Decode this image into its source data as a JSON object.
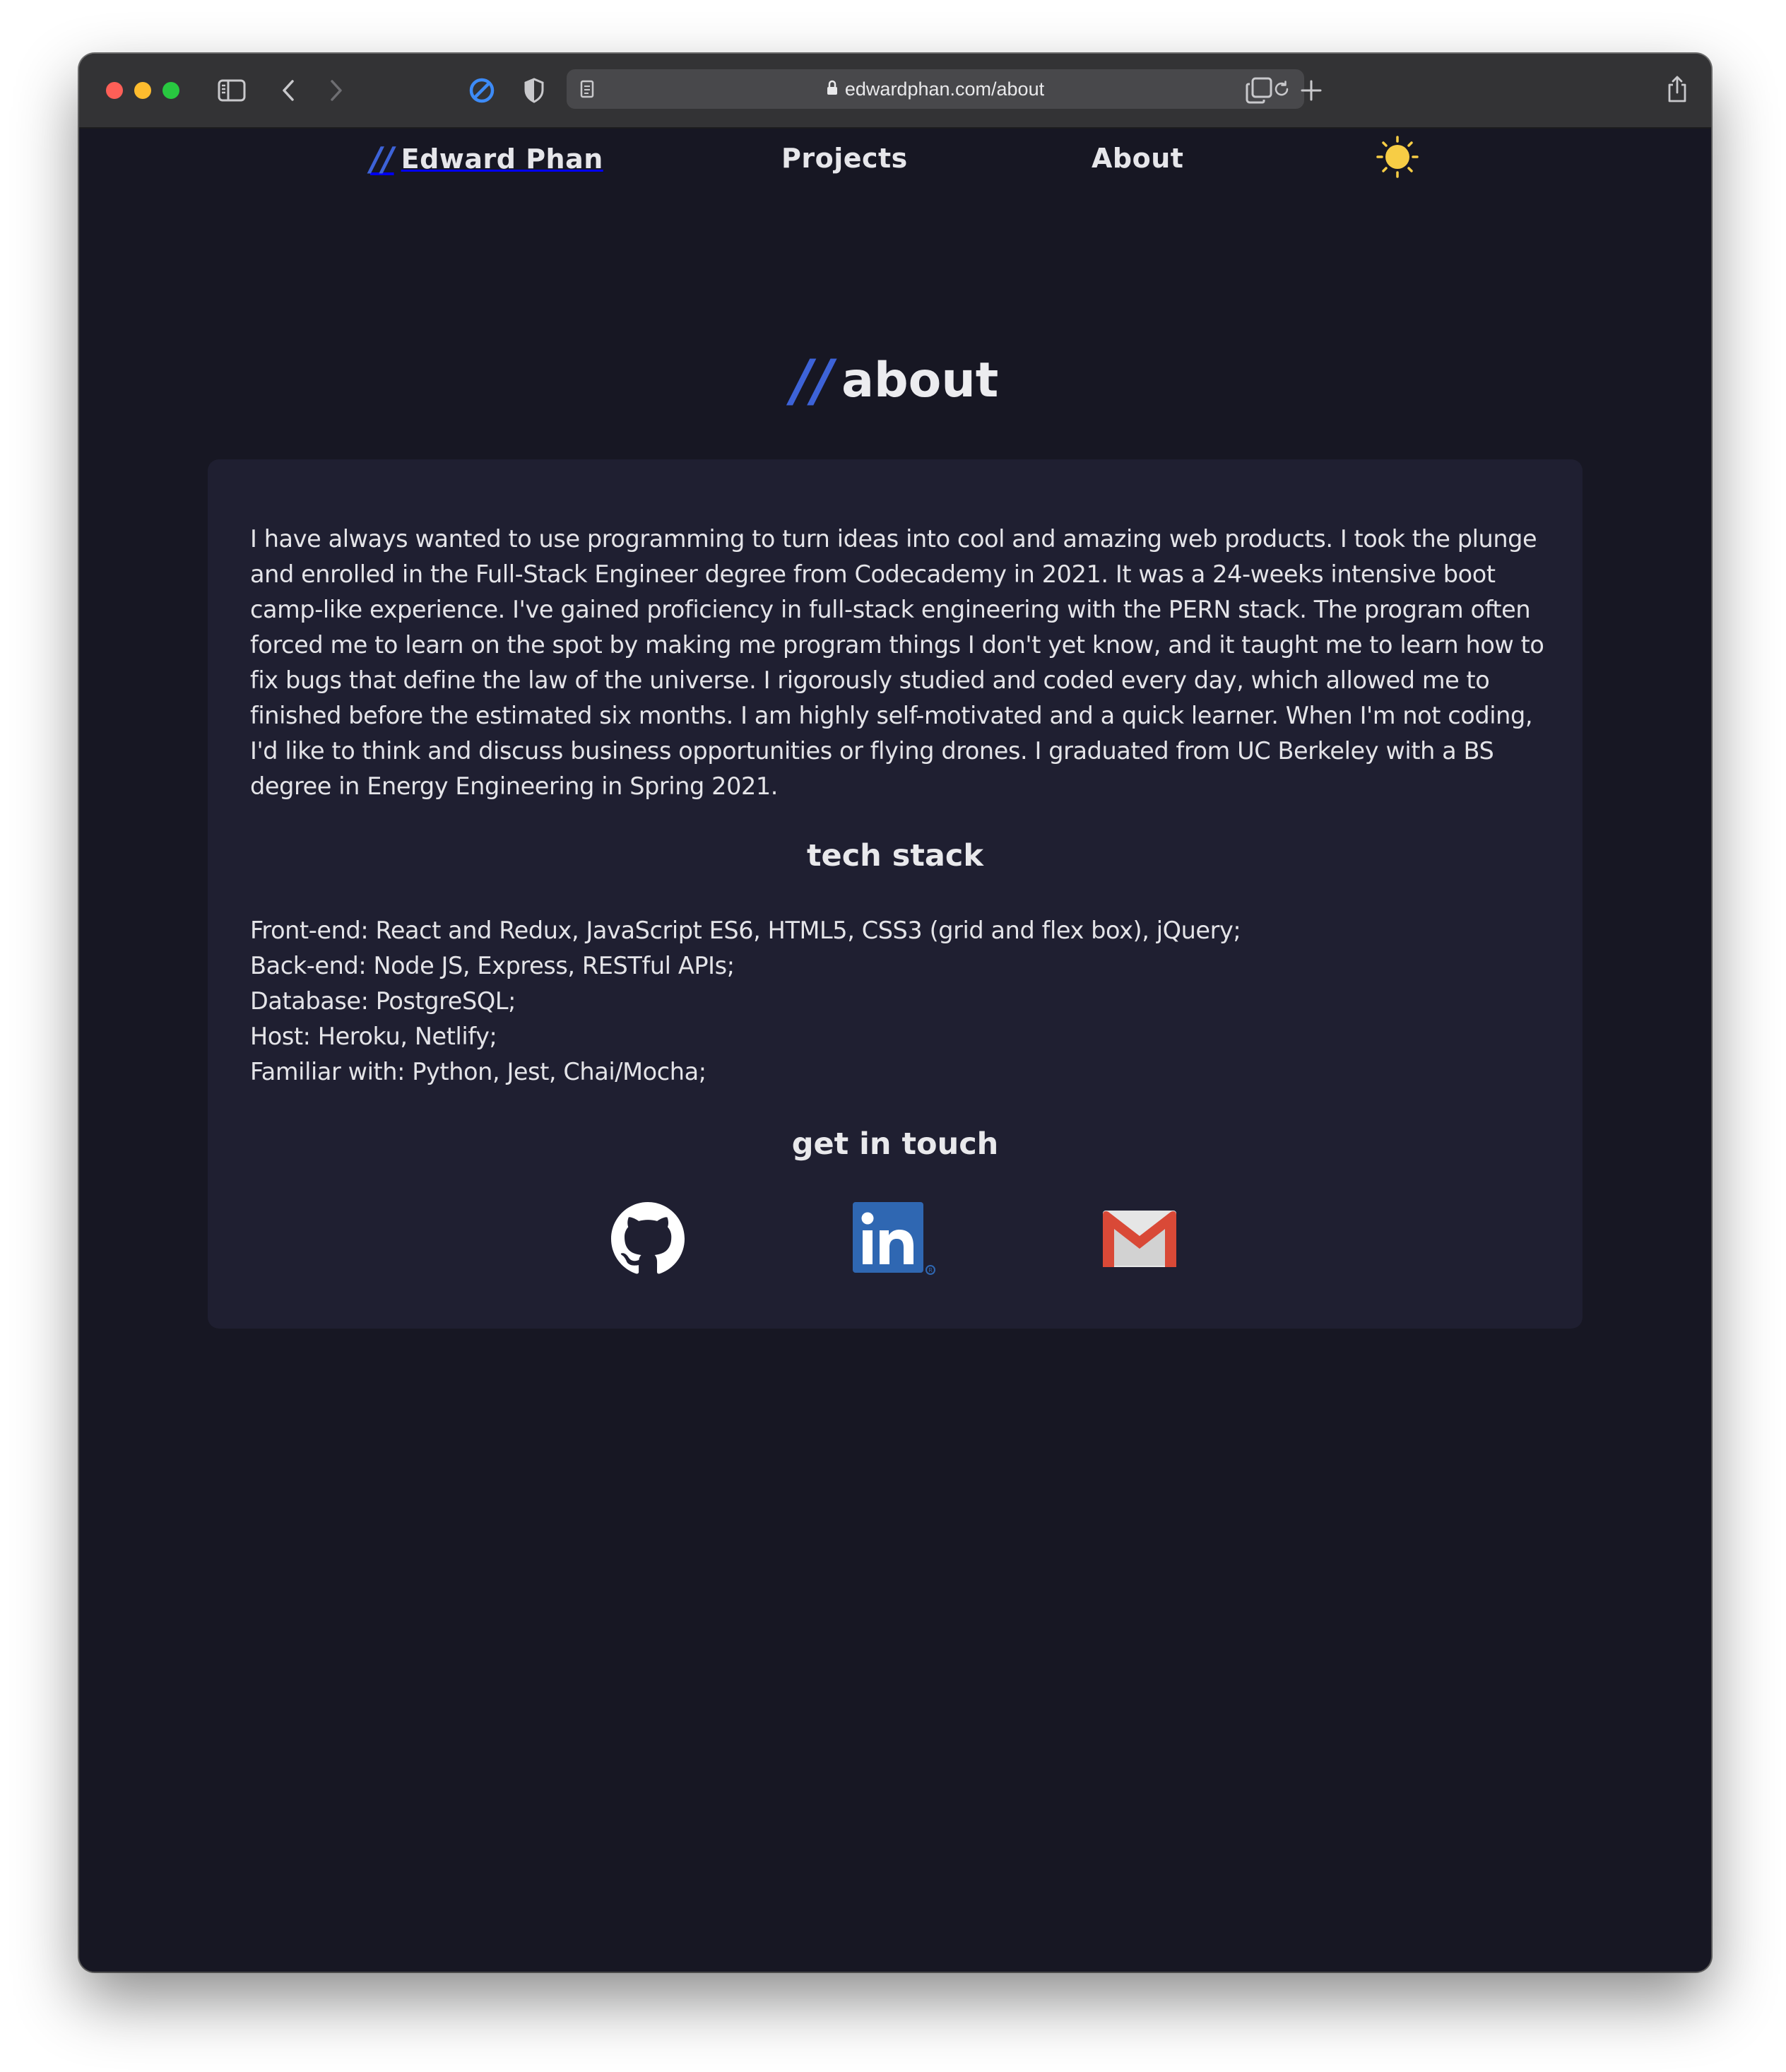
{
  "browser": {
    "url": "edwardphan.com/about"
  },
  "nav": {
    "brand_slashes": "//",
    "brand_name": "Edward Phan",
    "links": [
      {
        "label": "Projects"
      },
      {
        "label": "About"
      }
    ],
    "theme_icon": "sun-icon"
  },
  "about": {
    "heading_slashes": "//",
    "heading": "about",
    "bio": "I have always wanted to use programming to turn ideas into cool and amazing web products. I took the plunge and enrolled in the Full-Stack Engineer degree from Codecademy in 2021. It was a 24-weeks intensive boot camp-like experience. I've gained proficiency in full-stack engineering with the PERN stack. The program often forced me to learn on the spot by making me program things I don't yet know, and it taught me to learn how to fix bugs that define the law of the universe. I rigorously studied and coded every day, which allowed me to finished before the estimated six months. I am highly self-motivated and a quick learner. When I'm not coding, I'd like to think and discuss business opportunities or flying drones. I graduated from UC Berkeley with a BS degree in Energy Engineering in Spring 2021."
  },
  "tech_stack": {
    "heading": "tech stack",
    "items": [
      "Front-end: React and Redux, JavaScript ES6, HTML5, CSS3 (grid and flex box), jQuery;",
      "Back-end: Node JS, Express, RESTful APIs;",
      "Database: PostgreSQL;",
      "Host: Heroku, Netlify;",
      "Familiar with: Python, Jest, Chai/Mocha;"
    ]
  },
  "contact": {
    "heading": "get in touch",
    "links": [
      {
        "icon": "github-icon"
      },
      {
        "icon": "linkedin-icon"
      },
      {
        "icon": "gmail-icon"
      }
    ]
  },
  "colors": {
    "background": "#171723",
    "card": "#1f1f31",
    "accent": "#3d63d8",
    "sun": "#f7cd45"
  }
}
